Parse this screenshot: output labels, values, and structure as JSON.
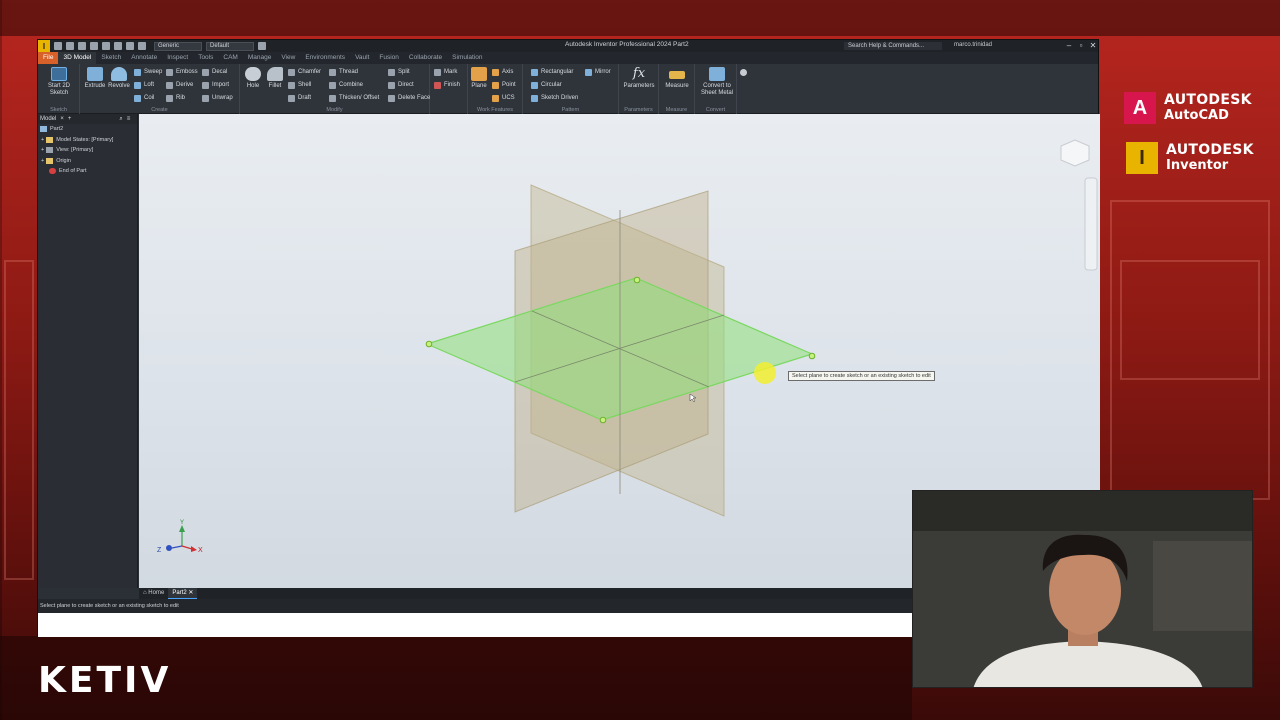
{
  "app": {
    "logo": "I",
    "title": "Autodesk Inventor Professional 2024 Part2",
    "appearance_select": "Generic",
    "material_select": "Default",
    "search_placeholder": "Search Help & Commands...",
    "user": "marco.trinidad"
  },
  "ribbon_tabs": [
    "File",
    "3D Model",
    "Sketch",
    "Annotate",
    "Inspect",
    "Tools",
    "CAM",
    "Manage",
    "View",
    "Environments",
    "Vault",
    "Fusion",
    "Collaborate",
    "Simulation"
  ],
  "ribbon": {
    "sketch": {
      "label": "Sketch",
      "start_2d": "Start 2D Sketch"
    },
    "create": {
      "label": "Create",
      "extrude": "Extrude",
      "revolve": "Revolve",
      "sweep": "Sweep",
      "loft": "Loft",
      "coil": "Coil",
      "emboss": "Emboss",
      "derive": "Derive",
      "rib": "Rib",
      "decal": "Decal",
      "import": "Import",
      "unwrap": "Unwrap"
    },
    "modify": {
      "label": "Modify",
      "hole": "Hole",
      "fillet": "Fillet",
      "chamfer": "Chamfer",
      "shell": "Shell",
      "draft": "Draft",
      "thread": "Thread",
      "combine": "Combine",
      "thicken": "Thicken/ Offset",
      "split": "Split",
      "direct": "Direct",
      "delete_face": "Delete Face"
    },
    "explore": {
      "mark": "Mark",
      "finish": "Finish"
    },
    "work_features": {
      "label": "Work Features",
      "plane": "Plane",
      "axis": "Axis",
      "point": "Point",
      "ucs": "UCS"
    },
    "pattern": {
      "label": "Pattern",
      "rectangular": "Rectangular",
      "circular": "Circular",
      "sketch_driven": "Sketch Driven",
      "mirror": "Mirror"
    },
    "parameters": {
      "label": "Parameters",
      "parameters": "Parameters"
    },
    "measure": {
      "label": "Measure",
      "measure": "Measure"
    },
    "convert": {
      "label": "Convert",
      "convert_sheet": "Convert to Sheet Metal"
    }
  },
  "browser": {
    "tab": "Model",
    "items": [
      "Part2",
      "Model States: [Primary]",
      "View: [Primary]",
      "Origin",
      "End of Part"
    ]
  },
  "viewport": {
    "tooltip": "Select plane to create sketch or an existing sketch to edit",
    "triad": {
      "x": "X",
      "y": "Y",
      "z": "Z"
    },
    "plane_colors": {
      "xy": "#c9c2a4",
      "yz": "#cbbf9a",
      "xz": "#8fe07a"
    }
  },
  "doc_tabs": [
    "Home",
    "Part2"
  ],
  "status": "Select plane to create sketch or an existing sketch to edit",
  "branding": {
    "autocad_company": "AUTODESK",
    "autocad_product": "AutoCAD",
    "autocad_logo": "A",
    "autocad_color": "#d6164c",
    "inventor_company": "AUTODESK",
    "inventor_product": "Inventor",
    "inventor_logo": "I",
    "inventor_color": "#e8b400",
    "ketiv": "KETIV"
  }
}
